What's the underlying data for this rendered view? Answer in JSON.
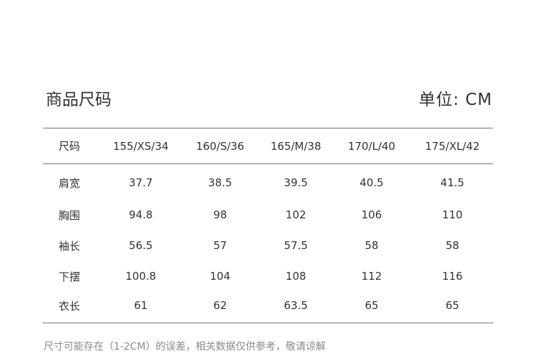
{
  "header": {
    "title": "商品尺码",
    "unit": "单位: CM"
  },
  "table": {
    "columns": [
      "尺码",
      "155/XS/34",
      "160/S/36",
      "165/M/38",
      "170/L/40",
      "175/XL/42"
    ],
    "rows": [
      {
        "label": "肩宽",
        "values": [
          "37.7",
          "38.5",
          "39.5",
          "40.5",
          "41.5"
        ]
      },
      {
        "label": "胸围",
        "values": [
          "94.8",
          "98",
          "102",
          "106",
          "110"
        ]
      },
      {
        "label": "袖长",
        "values": [
          "56.5",
          "57",
          "57.5",
          "58",
          "58"
        ]
      },
      {
        "label": "下摆",
        "values": [
          "100.8",
          "104",
          "108",
          "112",
          "116"
        ]
      },
      {
        "label": "衣长",
        "values": [
          "61",
          "62",
          "63.5",
          "65",
          "65"
        ]
      }
    ]
  },
  "footer": {
    "note": "尺寸可能存在（1-2CM）的误差，相关数据仅供参考，敬请谅解"
  }
}
